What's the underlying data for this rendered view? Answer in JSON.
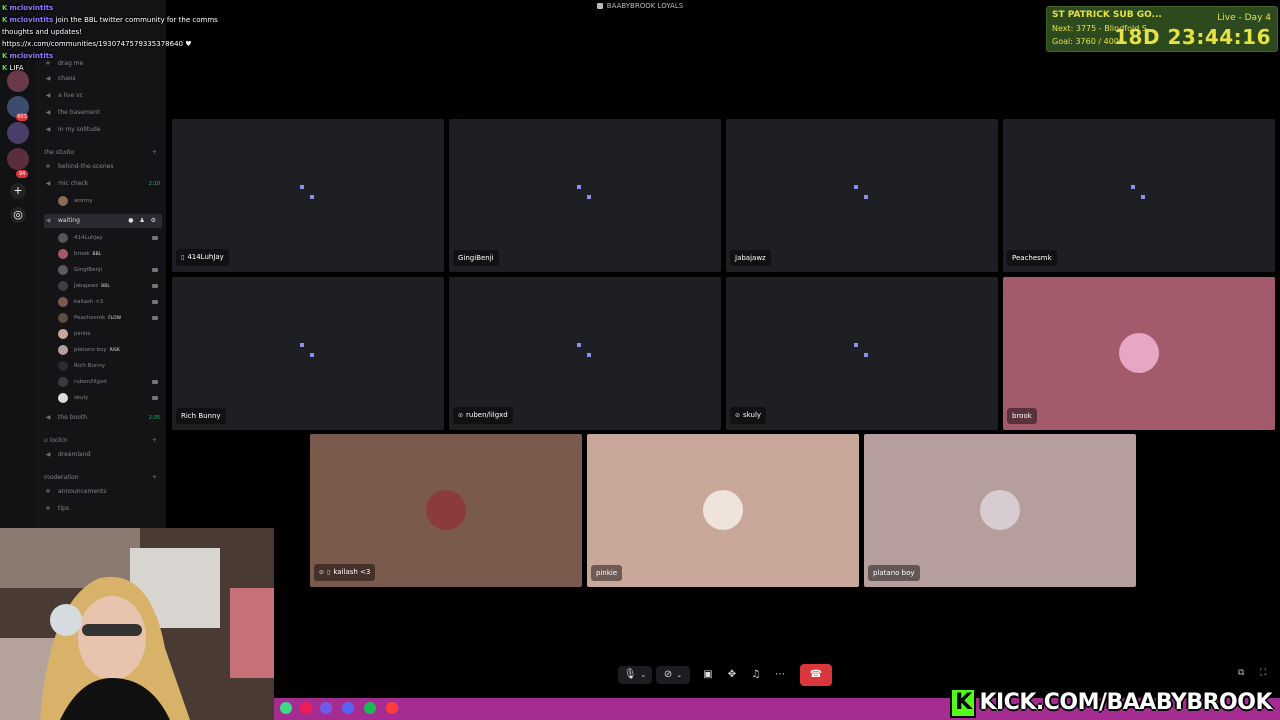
{
  "window": {
    "title": "BAABYBROOK LOYALS"
  },
  "chat_overlay": {
    "messages": [
      {
        "user": "mclovintits",
        "text": ""
      },
      {
        "user": "mclovintits",
        "text": "join the BBL twitter community for the comms thoughts and updates!"
      },
      {
        "user": "",
        "text": "https://x.com/communities/1930747579335378640"
      },
      {
        "user": "mclovintits",
        "text": "LIFA"
      }
    ]
  },
  "channels": {
    "top": [
      {
        "icon": "hash",
        "label": "drag me"
      },
      {
        "icon": "speaker",
        "label": "chaos"
      },
      {
        "icon": "speaker",
        "label": "a live vc"
      },
      {
        "icon": "speaker",
        "label": "the basement"
      },
      {
        "icon": "speaker",
        "label": "in my solitude"
      }
    ],
    "category_studio": "the studio",
    "studio": [
      {
        "icon": "hash",
        "label": "behind-the-scenes"
      },
      {
        "icon": "speaker",
        "label": "mic check",
        "time": "2:10"
      }
    ],
    "mic_check_members": [
      {
        "name": "wormy"
      }
    ],
    "waiting": {
      "label": "waiting"
    },
    "waiting_members": [
      {
        "name": "414LuhJay",
        "tag": ""
      },
      {
        "name": "brook",
        "tag": "BBL"
      },
      {
        "name": "GingiBenji",
        "tag": ""
      },
      {
        "name": "Jabajawz",
        "tag": "BBL"
      },
      {
        "name": "kailash <3",
        "tag": ""
      },
      {
        "name": "Peachesmk",
        "tag": "FLOW"
      },
      {
        "name": "pinkie",
        "tag": ""
      },
      {
        "name": "platano boy",
        "tag": "RISK"
      },
      {
        "name": "Rich Bunny",
        "tag": ""
      },
      {
        "name": "ruben/lilgxd",
        "tag": ""
      },
      {
        "name": "skuly",
        "tag": ""
      }
    ],
    "booth": {
      "label": "the booth",
      "time": "2:05"
    },
    "category_lockin": "u lockin",
    "dreamland": {
      "label": "dreamland"
    },
    "category_moderation": "moderation",
    "moderation": [
      {
        "icon": "hash",
        "label": "announcements"
      },
      {
        "icon": "hash",
        "label": "tips"
      }
    ]
  },
  "tiles": [
    {
      "name": "414LuhJay",
      "icon": "phone",
      "state": "loading"
    },
    {
      "name": "GingiBenji",
      "icon": "",
      "state": "loading"
    },
    {
      "name": "Jabajawz",
      "icon": "",
      "state": "loading"
    },
    {
      "name": "Peachesmk",
      "icon": "",
      "state": "loading"
    },
    {
      "name": "Rich Bunny",
      "icon": "",
      "state": "loading"
    },
    {
      "name": "ruben/lilgxd",
      "icon": "mic-muted",
      "state": "loading"
    },
    {
      "name": "skuly",
      "icon": "deafened",
      "state": "loading"
    },
    {
      "name": "brook",
      "icon": "",
      "state": "avatar",
      "bg": "#a35b6c"
    },
    {
      "name": "kailash <3",
      "icon": "deafened-phone",
      "state": "avatar",
      "bg": "#7a5a4d"
    },
    {
      "name": "pinkie",
      "icon": "",
      "state": "avatar",
      "bg": "#c9a79b"
    },
    {
      "name": "platano boy",
      "icon": "",
      "state": "avatar",
      "bg": "#b59e9b"
    }
  ],
  "subgoal": {
    "title": "ST PATRICK SUB GO...",
    "next": "Next: 3775 - Blindfold S",
    "goal": "Goal: 3760 / 4000",
    "live": "Live - Day 4",
    "timer": "18D 23:44:16"
  },
  "branding": {
    "kick_url": "KICK.COM/BAABYBROOK",
    "kick_letter": "K"
  },
  "colors": {
    "accent": "#5865f2",
    "end_call": "#da373c",
    "bottom_bar": "#a52c91",
    "kick_green": "#53fc18"
  }
}
